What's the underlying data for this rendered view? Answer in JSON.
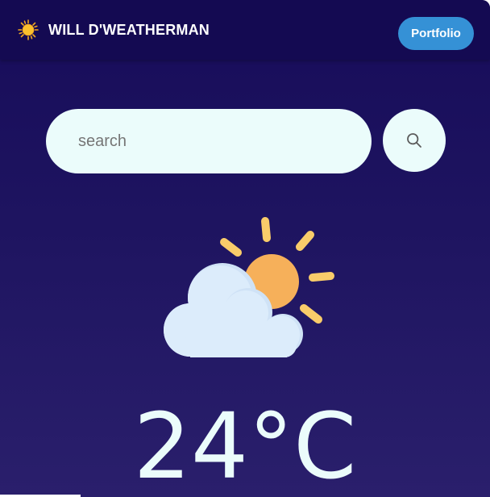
{
  "header": {
    "brand_icon": "sun-icon",
    "title": "WILL D'WEATHERMAN",
    "portfolio_label": "Portfolio"
  },
  "search": {
    "placeholder": "search",
    "value": "",
    "button_icon": "search-icon"
  },
  "weather": {
    "icon": "partly-cloudy-icon",
    "temperature": "24°C"
  },
  "colors": {
    "background_top": "#170c5a",
    "background_bottom": "#2a1f6c",
    "header": "#140a52",
    "accent": "#3591d6",
    "input_bg": "#ebfcfb",
    "sun": "#f6b05a",
    "cloud": "#dcecfb"
  }
}
